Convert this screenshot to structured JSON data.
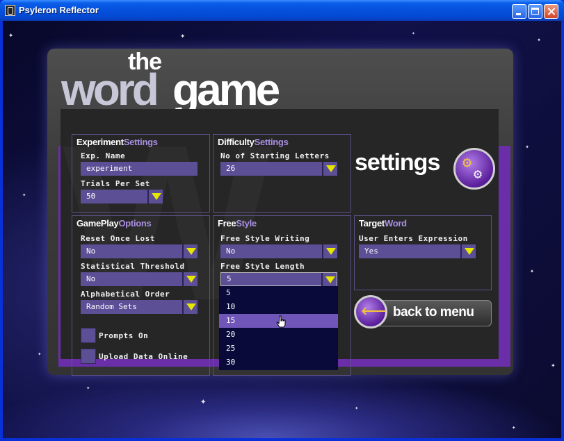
{
  "window": {
    "title": "Psyleron Reflector"
  },
  "logo": {
    "the": "the",
    "word": "word",
    "game": "game"
  },
  "heading": {
    "settings": "settings"
  },
  "experiment": {
    "title_a": "Experiment",
    "title_b": "Settings",
    "exp_name_label": "Exp. Name",
    "exp_name_value": "experiment",
    "trials_label": "Trials Per Set",
    "trials_value": "50"
  },
  "difficulty": {
    "title_a": "Difficulty",
    "title_b": "Settings",
    "start_letters_label": "No of Starting Letters",
    "start_letters_value": "26"
  },
  "gameplay": {
    "title_a": "GamePlay",
    "title_b": "Options",
    "reset_label": "Reset Once Lost",
    "reset_value": "No",
    "stat_label": "Statistical Threshold",
    "stat_value": "No",
    "alpha_label": "Alphabetical Order",
    "alpha_value": "Random Sets",
    "prompts_label": "Prompts On",
    "upload_label": "Upload Data Online"
  },
  "freestyle": {
    "title_a": "Free",
    "title_b": "Style",
    "writing_label": "Free Style Writing",
    "writing_value": "No",
    "length_label": "Free Style Length",
    "length_value": "5",
    "length_options": [
      "5",
      "10",
      "15",
      "20",
      "25",
      "30"
    ],
    "length_highlighted": "15"
  },
  "target": {
    "title_a": "Target",
    "title_b": "Word",
    "user_label": "User Enters Expression",
    "user_value": "Yes"
  },
  "back": {
    "label": "back to menu"
  },
  "colors": {
    "accent": "#a98fe3",
    "field": "#5c4f96",
    "arrow": "#e6e600",
    "highlight": "#7056b8"
  }
}
